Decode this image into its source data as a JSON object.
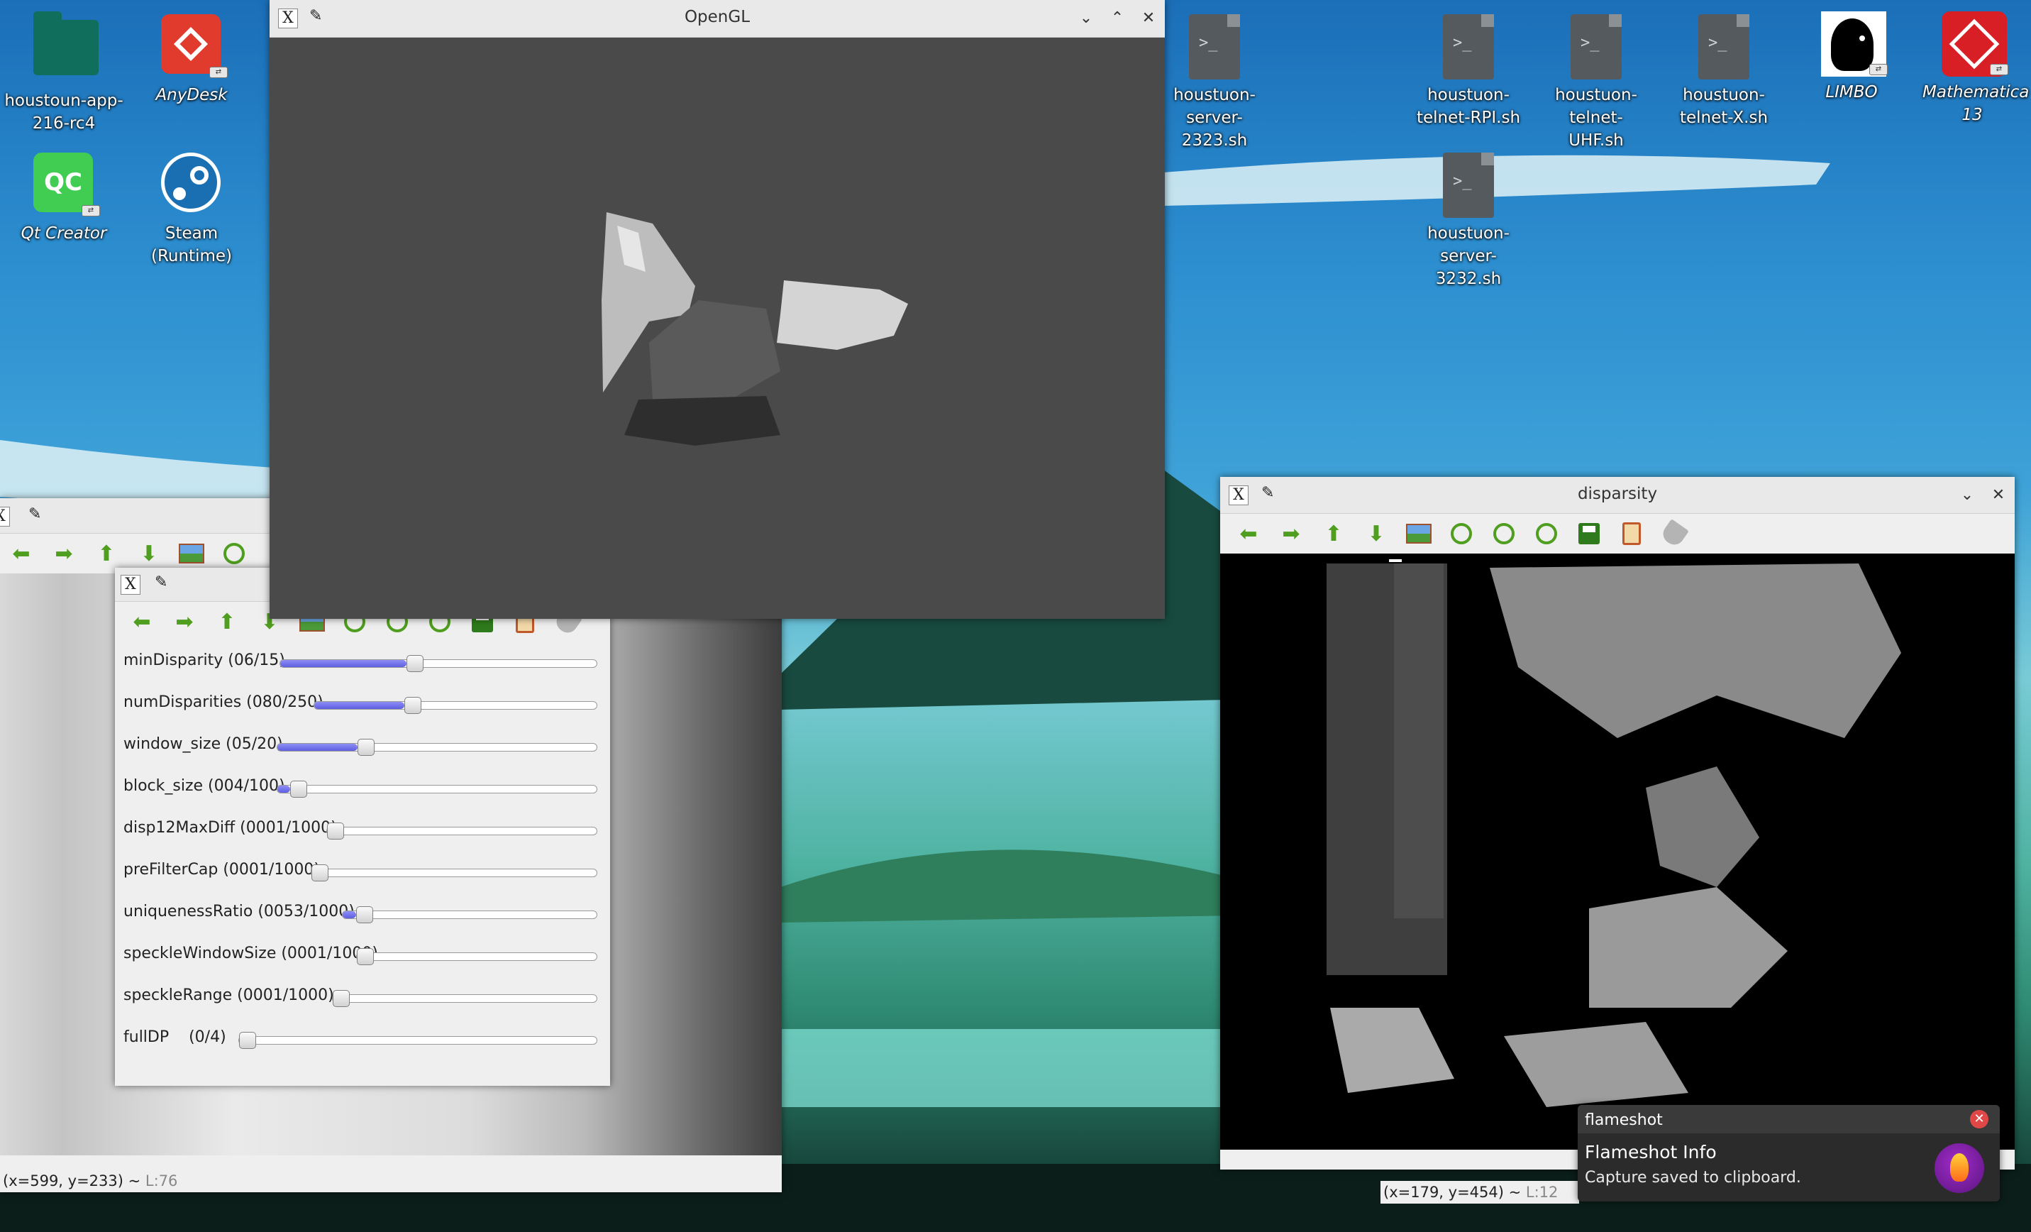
{
  "desktop": {
    "icons": [
      {
        "label": "houstoun-app-216-rc4"
      },
      {
        "label": "AnyDesk"
      },
      {
        "label": "Qt Creator",
        "glyph": "QC"
      },
      {
        "label": "Steam (Runtime)"
      },
      {
        "label": "houstuon-server-2323.sh"
      },
      {
        "label": "houstuon-telnet-RPI.sh"
      },
      {
        "label": "houstuon-telnet-UHF.sh"
      },
      {
        "label": "houstuon-telnet-X.sh"
      },
      {
        "label": "LIMBO"
      },
      {
        "label": "Mathematica 13"
      },
      {
        "label": "houstuon-server-3232.sh"
      }
    ],
    "script_glyph": ">_",
    "link_badge": "⇄"
  },
  "opengl_window": {
    "title": "OpenGL"
  },
  "camera_window": {
    "status_coords": "(x=599, y=233) ~",
    "status_level": "L:76"
  },
  "trackbars_window": {
    "sliders": [
      {
        "label": "minDisparity (06/15)",
        "value": 6,
        "max": 15
      },
      {
        "label": "numDisparities (080/250)",
        "value": 80,
        "max": 250
      },
      {
        "label": "window_size (05/20)",
        "value": 5,
        "max": 20
      },
      {
        "label": "block_size (004/100)",
        "value": 4,
        "max": 100
      },
      {
        "label": "disp12MaxDiff (0001/1000)",
        "value": 1,
        "max": 1000
      },
      {
        "label": "preFilterCap (0001/1000)",
        "value": 1,
        "max": 1000
      },
      {
        "label": "uniquenessRatio (0053/1000)",
        "value": 53,
        "max": 1000
      },
      {
        "label": "speckleWindowSize (0001/1000)",
        "value": 1,
        "max": 1000
      },
      {
        "label": "speckleRange (0001/1000)",
        "value": 1,
        "max": 1000
      },
      {
        "label": "fullDP    (0/4)",
        "value": 0,
        "max": 4
      }
    ]
  },
  "disparity_window": {
    "title": "disparsity",
    "status_coords": "(x=179, y=454) ~",
    "status_level": "L:12"
  },
  "notification": {
    "app": "flameshot",
    "title": "Flameshot Info",
    "body": "Capture saved to clipboard.",
    "close_glyph": "✕"
  },
  "toolbar_glyphs": {
    "left": "⬅",
    "right": "➡",
    "up": "⬆",
    "down": "⬇"
  },
  "colors": {
    "toolbar_green": "#4f9e1f",
    "slider_fill": "#6f6fe8",
    "opengl_bg": "#4a4a4a",
    "flameshot_bg": "#2b2b2b"
  }
}
